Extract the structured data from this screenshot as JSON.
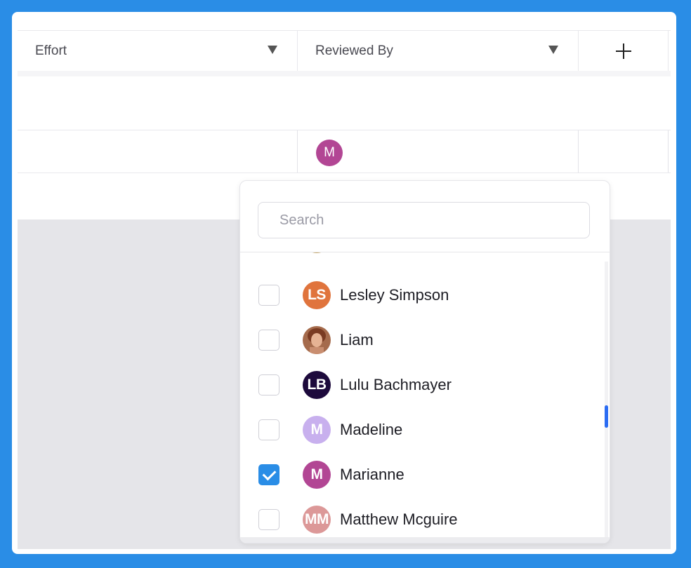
{
  "table": {
    "columns": [
      {
        "label": "Effort"
      },
      {
        "label": "Reviewed By"
      }
    ],
    "add_column_icon": "plus-icon",
    "row": {
      "reviewed_by_avatar": {
        "initials": "M",
        "color": "#b24694"
      }
    }
  },
  "dropdown": {
    "search_placeholder": "Search",
    "items": [
      {
        "name": "",
        "initials": "",
        "color": "#c8a96a",
        "checked": false,
        "partial": true
      },
      {
        "name": "Lesley Simpson",
        "initials": "LS",
        "color": "#e0743d",
        "checked": false
      },
      {
        "name": "Liam",
        "initials": "",
        "color": "#8a5a45",
        "checked": false,
        "photo": true
      },
      {
        "name": "Lulu Bachmayer",
        "initials": "LB",
        "color": "#1d0a3c",
        "checked": false
      },
      {
        "name": "Madeline",
        "initials": "M",
        "color": "#c8b0ee",
        "checked": false
      },
      {
        "name": "Marianne",
        "initials": "M",
        "color": "#b24694",
        "checked": true
      },
      {
        "name": "Matthew Mcguire",
        "initials": "MM",
        "color": "#dc9898",
        "checked": false
      }
    ]
  },
  "colors": {
    "accent": "#2a8de6",
    "scrollbar": "#2b6cf2"
  }
}
